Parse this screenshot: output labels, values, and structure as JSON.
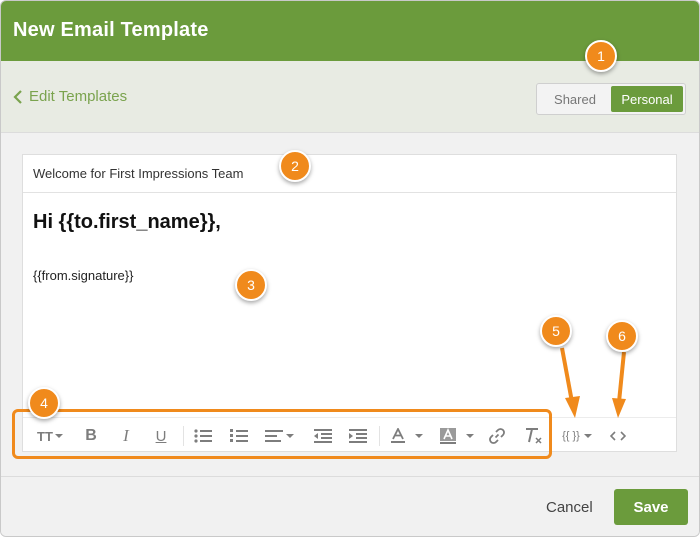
{
  "dialog": {
    "title": "New Email Template"
  },
  "nav": {
    "back_label": "Edit Templates"
  },
  "scope_toggle": {
    "options": [
      {
        "label": "Shared",
        "selected": false
      },
      {
        "label": "Personal",
        "selected": true
      }
    ]
  },
  "editor": {
    "template_name_value": "Welcome for First Impressions Team",
    "greeting": "Hi {{to.first_name}},",
    "signature": "{{from.signature}}"
  },
  "toolbar": {
    "text_size_label": "TT",
    "variables_label": "{{ }}"
  },
  "footer": {
    "cancel_label": "Cancel",
    "save_label": "Save"
  },
  "annotations": [
    "1",
    "2",
    "3",
    "4",
    "5",
    "6"
  ],
  "colors": {
    "brand_green": "#6b9b3c",
    "annotation_orange": "#f08a1c"
  }
}
